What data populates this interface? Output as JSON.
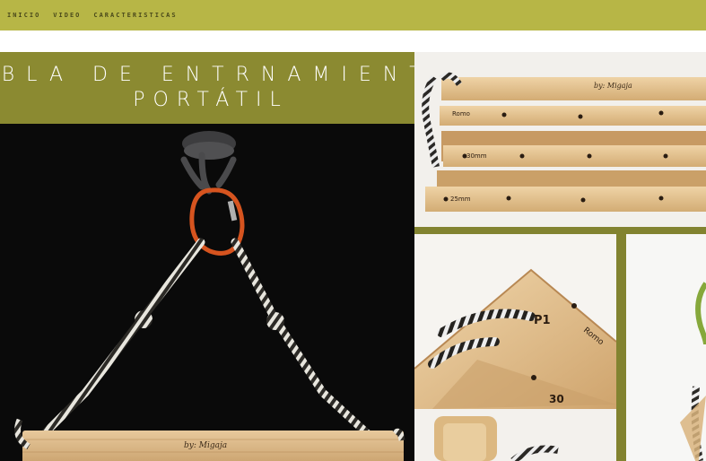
{
  "nav": {
    "items": [
      {
        "label": "INICIO"
      },
      {
        "label": "VIDEO"
      },
      {
        "label": "CARACTERISTICAS"
      }
    ]
  },
  "hero": {
    "title_line1": "TABLA DE ENTRNAMIENTO",
    "title_line2": "PORTÁTIL",
    "board_brand": "by: Migaja"
  },
  "thumbs": {
    "top": {
      "brand": "by: Migaja",
      "rows": [
        "Romo",
        "30mm",
        "25mm"
      ]
    },
    "mid": {
      "labels": [
        "P1",
        "Romo",
        "30"
      ]
    }
  },
  "colors": {
    "nav_bg": "#b7b646",
    "banner_bg": "#8b8a31",
    "band": "#828330",
    "carabiner": "#d6541f"
  }
}
